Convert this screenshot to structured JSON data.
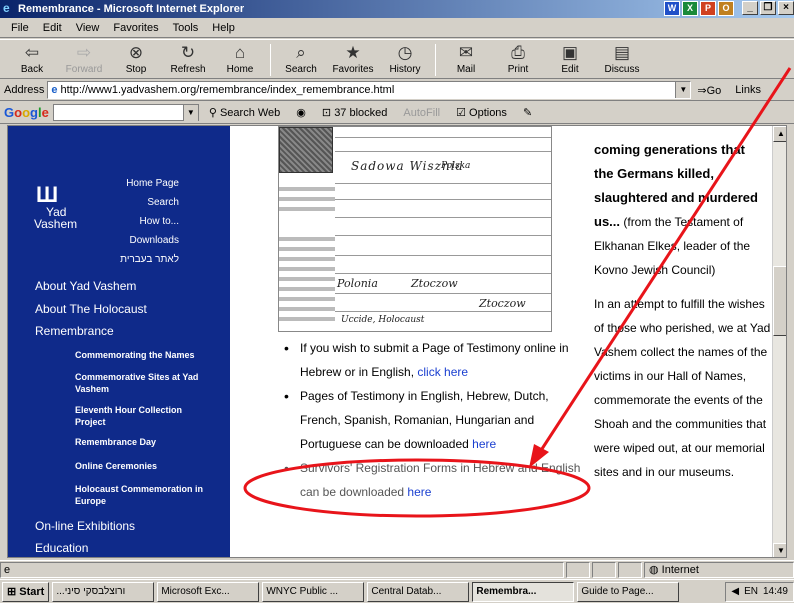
{
  "window": {
    "title": "Remembrance - Microsoft Internet Explorer",
    "controls": [
      "_",
      "❐",
      "×"
    ]
  },
  "menubar": [
    "File",
    "Edit",
    "View",
    "Favorites",
    "Tools",
    "Help"
  ],
  "toolbar": {
    "back": "Back",
    "forward": "Forward",
    "stop": "Stop",
    "refresh": "Refresh",
    "home": "Home",
    "search": "Search",
    "favorites": "Favorites",
    "history": "History",
    "mail": "Mail",
    "print": "Print",
    "edit": "Edit",
    "discuss": "Discuss"
  },
  "address": {
    "label": "Address",
    "url": "http://www1.yadvashem.org/remembrance/index_remembrance.html",
    "go": "Go",
    "links": "Links"
  },
  "google": {
    "logo": "Google",
    "search_web": "Search Web",
    "blocked": "37 blocked",
    "autofill": "AutoFill",
    "options": "Options"
  },
  "sidebar": {
    "logo_yad": "Yad",
    "logo_vashem": "Vashem",
    "top_links": [
      "Home Page",
      "Search",
      "How to...",
      "Downloads",
      "לאתר בעברית"
    ],
    "nav": [
      "About Yad Vashem",
      "About The Holocaust",
      "Remembrance"
    ],
    "sub_nav": [
      "Commemorating the Names",
      "Commemorative Sites at Yad Vashem",
      "Eleventh Hour Collection Project",
      "Remembrance Day",
      "Online Ceremonies",
      "Holocaust Commemoration in Europe"
    ],
    "bottom_nav": [
      "On-line Exhibitions",
      "Education"
    ]
  },
  "document_image": {
    "handwriting": [
      "Sadowa Wisznia",
      "Polska",
      "Polonia",
      "Ztoczow",
      "Ztoczow",
      "Uccide, Holocaust"
    ]
  },
  "main": {
    "bullet1_text": "If you wish to submit a Page of Testimony online in Hebrew or in English, ",
    "bullet1_link": "click here",
    "bullet2_text": "Pages of Testimony in English, Hebrew, Dutch, French, Spanish, Romanian, Hungarian and Portuguese can be downloaded ",
    "bullet2_link": "here",
    "bullet3_text": "Survivors' Registration Forms in Hebrew and English can be downloaded ",
    "bullet3_link": "here"
  },
  "quote": {
    "lines": [
      "coming generations that",
      "the Germans killed,",
      "slaughtered and murdered",
      "us..."
    ],
    "attribution": "(from the Testament of Elkhanan Elkes, leader of the Kovno Jewish Council)",
    "para": "In an attempt to fulfill the wishes of those who perished, we at Yad Vashem collect the names of the victims in our Hall of Names, commemorate the events of the Shoah and the communities that were wiped out, at our memorial sites and in our museums."
  },
  "status": {
    "zone": "Internet"
  },
  "taskbar": {
    "start": "Start",
    "tasks": [
      "...ורוצלבסקי סיני",
      "Microsoft Exc...",
      "WNYC Public ...",
      "Central Datab...",
      "Remembra...",
      "Guide to Page..."
    ],
    "active_index": 4,
    "time": "14:49",
    "lang": "EN"
  },
  "annotation": {
    "color": "#e8141a"
  }
}
